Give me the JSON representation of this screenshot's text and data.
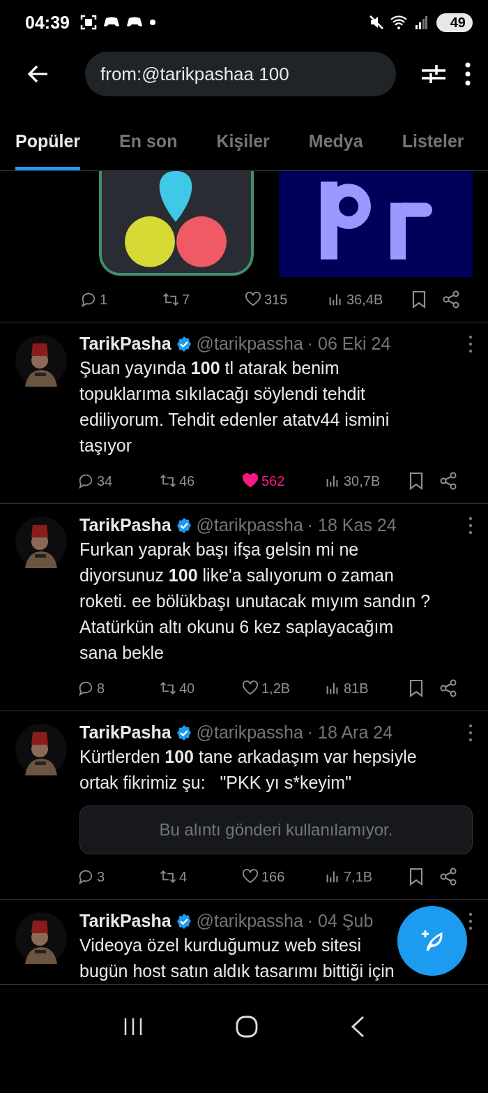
{
  "status_bar": {
    "time": "04:39",
    "battery": "49"
  },
  "search": {
    "value": "from:@tarikpashaa 100"
  },
  "tabs": [
    {
      "label": "Popüler",
      "selected": true
    },
    {
      "label": "En son",
      "selected": false
    },
    {
      "label": "Kişiler",
      "selected": false
    },
    {
      "label": "Medya",
      "selected": false
    },
    {
      "label": "Listeler",
      "selected": false
    }
  ],
  "first_post": {
    "actions": {
      "replies": "1",
      "reposts": "7",
      "likes": "315",
      "liked": false,
      "views": "36,4B"
    }
  },
  "posts": [
    {
      "name": "TarikPasha",
      "handle": "@tarikpassha",
      "date": "· 06 Eki 24",
      "text": "Şuan yayında **100** tl atarak benim\ntopuklarıma sıkılacağı söylendi tehdit\nediliyorum. Tehdit edenler atatv44 ismini\ntaşıyor",
      "actions": {
        "replies": "34",
        "reposts": "46",
        "likes": "562",
        "liked": true,
        "views": "30,7B"
      }
    },
    {
      "name": "TarikPasha",
      "handle": "@tarikpassha",
      "date": "· 18 Kas 24",
      "text": "Furkan yaprak başı ifşa gelsin mi ne\ndiyorsunuz **100** like'a salıyorum o zaman\nroketi. ee bölükbaşı unutacak mıyım sandın ?\nAtatürkün altı okunu 6 kez saplayacağım\nsana bekle",
      "actions": {
        "replies": "8",
        "reposts": "40",
        "likes": "1,2B",
        "liked": false,
        "views": "81B"
      }
    },
    {
      "name": "TarikPasha",
      "handle": "@tarikpassha",
      "date": "· 18 Ara 24",
      "text": "Kürtlerden **100** tane arkadaşım var hepsiyle\nortak fikrimiz şu:   \"PKK yı s*keyim\"",
      "quote_notice": "Bu alıntı gönderi kullanılamıyor.",
      "actions": {
        "replies": "3",
        "reposts": "4",
        "likes": "166",
        "liked": false,
        "views": "7,1B"
      }
    },
    {
      "name": "TarikPasha",
      "handle": "@tarikpassha",
      "date": "· 04 Şub",
      "text": "Videoya özel kurduğumuz web sitesi\nbugün host satın aldık tasarımı bittiği için"
    }
  ]
}
